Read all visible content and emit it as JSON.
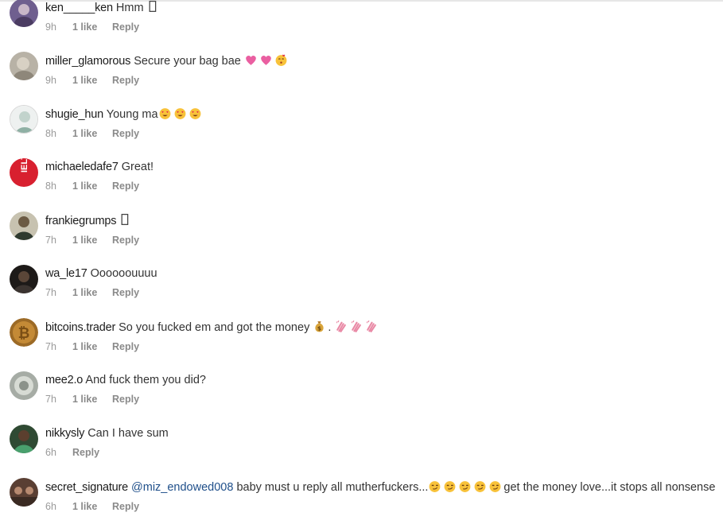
{
  "comments": [
    {
      "username": "ken_____ken",
      "text": "Hmm",
      "emojis": [
        "box"
      ],
      "time": "9h",
      "likes": "1 like",
      "reply": "Reply",
      "avatar_color": "#6f5f8f"
    },
    {
      "username": "miller_glamorous",
      "text": "Secure your bag bae",
      "emojis": [
        "pink-heart",
        "pink-heart",
        "kissing-face"
      ],
      "time": "9h",
      "likes": "1 like",
      "reply": "Reply",
      "avatar_color": "#b8b2a6"
    },
    {
      "username": "shugie_hun",
      "text": "Young ma",
      "emojis": [
        "heart-eyes",
        "heart-eyes",
        "heart-eyes"
      ],
      "time": "8h",
      "likes": "1 like",
      "reply": "Reply",
      "avatar_color": "#dfe5e3"
    },
    {
      "username": "michaeledafe7",
      "text": "Great!",
      "emojis": [],
      "time": "8h",
      "likes": "1 like",
      "reply": "Reply",
      "avatar_color": "#d8202f",
      "avatar_text": "IELTS"
    },
    {
      "username": "frankiegrumps",
      "text": "",
      "emojis": [
        "box"
      ],
      "time": "7h",
      "likes": "1 like",
      "reply": "Reply",
      "avatar_color": "#4a4a3a"
    },
    {
      "username": "wa_le17",
      "text": "Oooooouuuu",
      "emojis": [],
      "time": "7h",
      "likes": "1 like",
      "reply": "Reply",
      "avatar_color": "#2a2522"
    },
    {
      "username": "bitcoins.trader",
      "text": "So you fucked em and got the money",
      "emojis": [
        "money-bag"
      ],
      "text2": ".",
      "emojis2": [
        "clap",
        "clap",
        "clap"
      ],
      "time": "7h",
      "likes": "1 like",
      "reply": "Reply",
      "avatar_color": "#9c6a26"
    },
    {
      "username": "mee2.o",
      "text": "And fuck them you did?",
      "emojis": [],
      "time": "7h",
      "likes": "1 like",
      "reply": "Reply",
      "avatar_color": "#a6aca5"
    },
    {
      "username": "nikkysly",
      "text": "Can I have sum",
      "emojis": [],
      "time": "6h",
      "likes": "",
      "reply": "Reply",
      "avatar_color": "#2f4a33"
    },
    {
      "username": "secret_signature",
      "mention": "@miz_endowed008",
      "text": "baby must u reply all mutherfuckers...",
      "emojis": [
        "smirk",
        "smirk",
        "smirk",
        "smirk",
        "smirk"
      ],
      "text2": "get the money love...it stops all nonsense",
      "time": "6h",
      "likes": "1 like",
      "reply": "Reply",
      "avatar_color": "#5a3f33"
    }
  ],
  "colors": {
    "username": "#1c1c1c",
    "meta": "#9a9a9a",
    "mention": "#1f4f8a"
  }
}
